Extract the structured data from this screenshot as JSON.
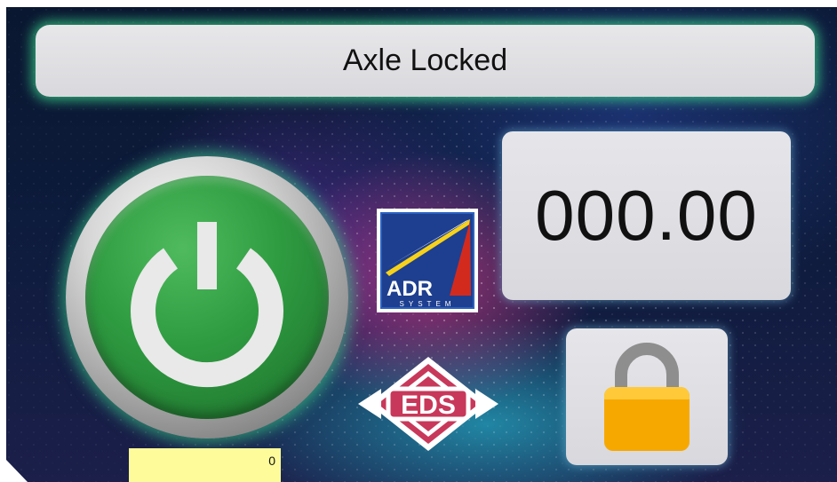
{
  "status": {
    "text": "Axle Locked"
  },
  "display": {
    "value": "000.00"
  },
  "counter": {
    "value": "0"
  },
  "logos": {
    "adr": {
      "text": "ADR",
      "subtext": "SYSTEM"
    },
    "eds": {
      "text": "EDS"
    }
  },
  "icons": {
    "power": "power-icon",
    "lock": "padlock-icon"
  },
  "colors": {
    "status_glow": "#3cdc8c",
    "power_green": "#2e9a40",
    "lock_body": "#f7a800",
    "counter_bg": "#fdfb9a"
  }
}
